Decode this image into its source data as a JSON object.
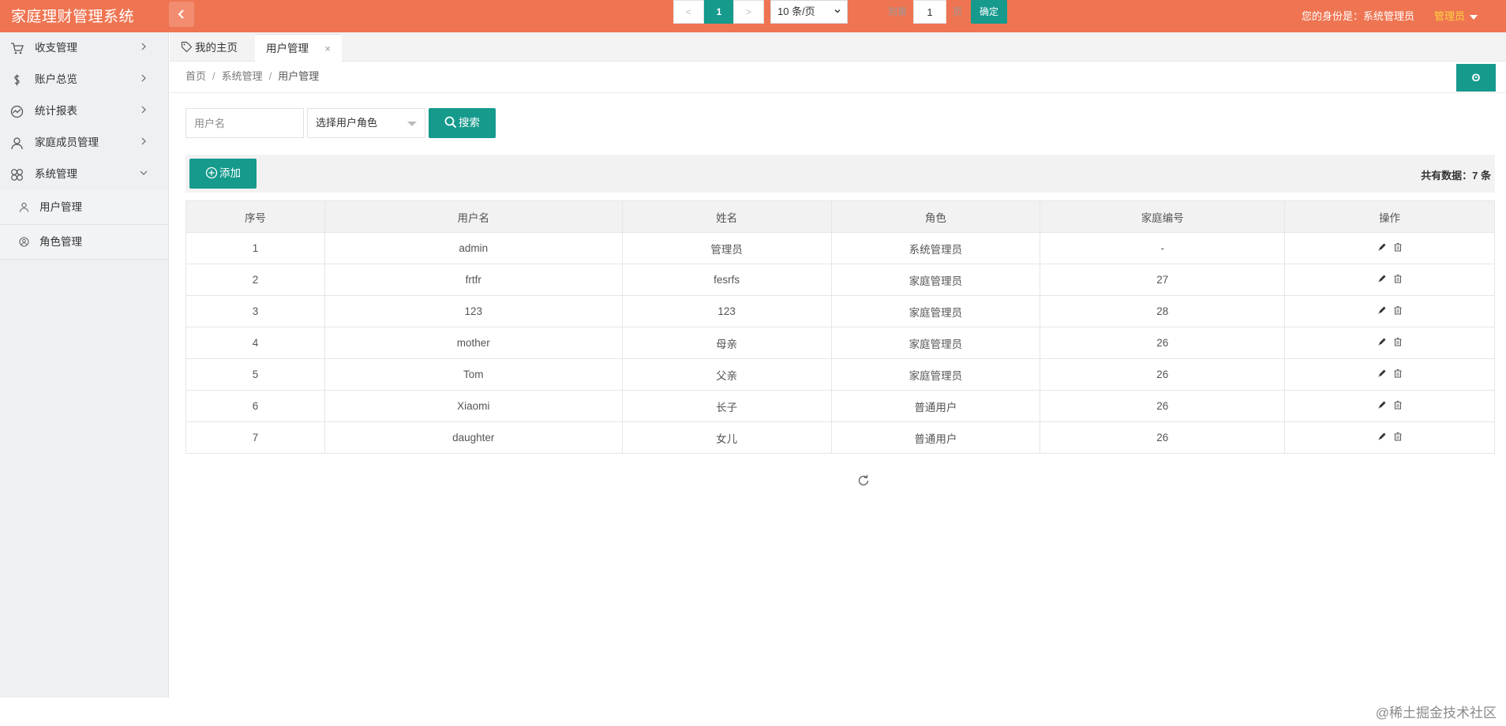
{
  "header": {
    "title": "家庭理财管理系统",
    "identity_label": "您的身份是：系统管理员",
    "user_menu_label": "管理员"
  },
  "sidebar": {
    "items": [
      {
        "label": "收支管理",
        "icon": "cart-icon"
      },
      {
        "label": "账户总览",
        "icon": "dollar-icon"
      },
      {
        "label": "统计报表",
        "icon": "chart-icon"
      },
      {
        "label": "家庭成员管理",
        "icon": "user-icon"
      },
      {
        "label": "系统管理",
        "icon": "clover-icon"
      }
    ],
    "sub_items": [
      {
        "label": "用户管理",
        "icon": "person-icon"
      },
      {
        "label": "角色管理",
        "icon": "role-icon"
      }
    ]
  },
  "tabs": [
    {
      "label": "我的主页"
    },
    {
      "label": "用户管理",
      "close": "×"
    }
  ],
  "breadcrumb": [
    "首页",
    "系统管理",
    "用户管理"
  ],
  "breadcrumb_sep": "/",
  "refresh_label": "ʘ",
  "search": {
    "username_placeholder": "用户名",
    "role_placeholder": "选择用户角色",
    "button_label": "搜索"
  },
  "toolbar": {
    "add_label": "添加",
    "total_text": "共有数据：7 条"
  },
  "table": {
    "columns": [
      "序号",
      "用户名",
      "姓名",
      "角色",
      "家庭编号",
      "操作"
    ],
    "rows": [
      [
        "1",
        "admin",
        "管理员",
        "系统管理员",
        "-"
      ],
      [
        "2",
        "frtfr",
        "fesrfs",
        "家庭管理员",
        "27"
      ],
      [
        "3",
        "123",
        "123",
        "家庭管理员",
        "28"
      ],
      [
        "4",
        "mother",
        "母亲",
        "家庭管理员",
        "26"
      ],
      [
        "5",
        "Tom",
        "父亲",
        "家庭管理员",
        "26"
      ],
      [
        "6",
        "Xiaomi",
        "长子",
        "普通用户",
        "26"
      ],
      [
        "7",
        "daughter",
        "女儿",
        "普通用户",
        "26"
      ]
    ]
  },
  "pagination": {
    "prev": "<",
    "current": "1",
    "next": ">",
    "page_size": "10 条/页",
    "goto_label": "到第",
    "goto_value": "1",
    "page_unit": "页",
    "confirm_label": "确定"
  },
  "footer_mark": "@稀土掘金技术社区",
  "colors": {
    "header": "#ef7552",
    "accent": "#159a8c",
    "user_menu": "#ffd23f"
  }
}
